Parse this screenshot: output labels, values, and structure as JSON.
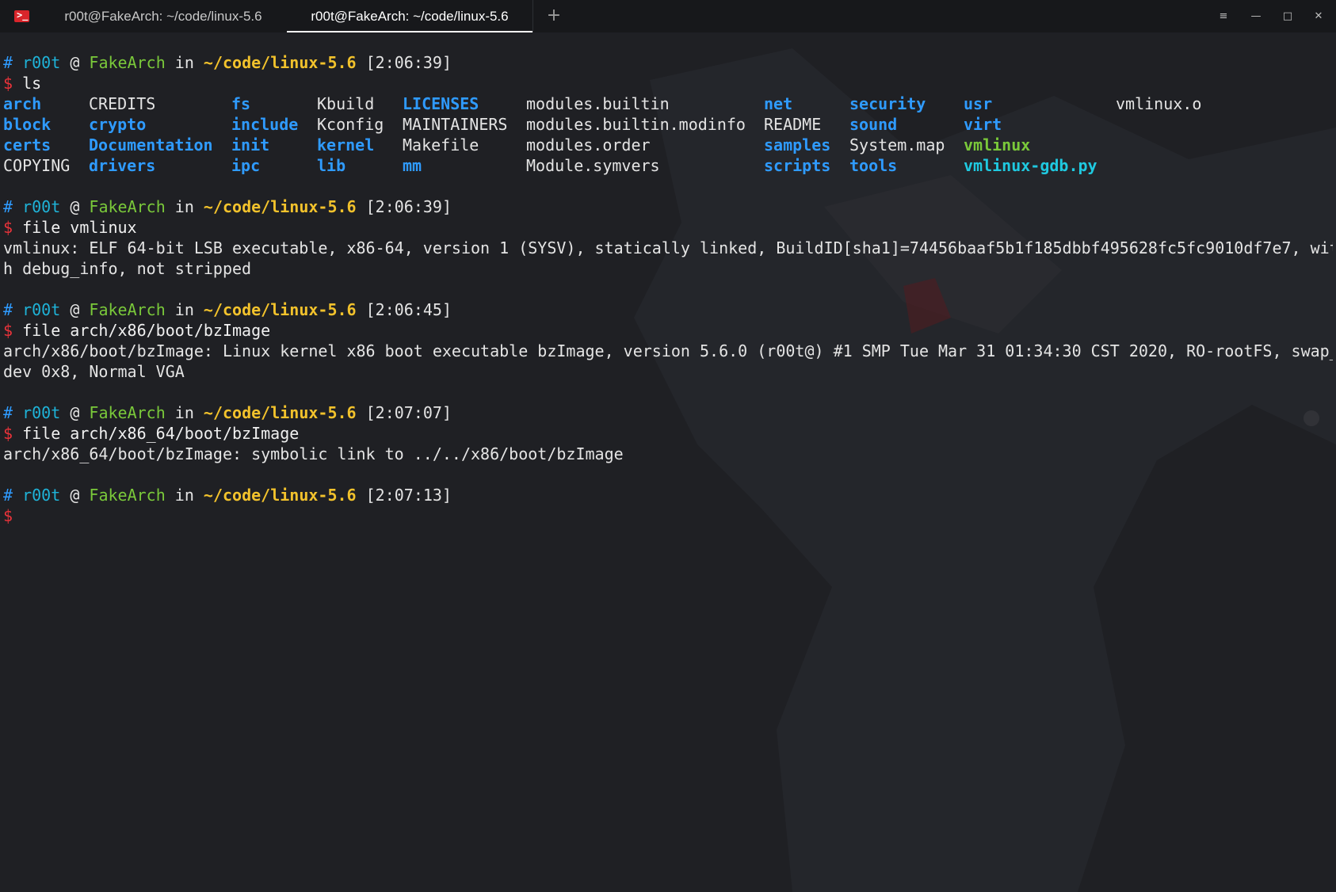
{
  "window": {
    "tabs": [
      {
        "label": "r00t@FakeArch: ~/code/linux-5.6",
        "active": false
      },
      {
        "label": "r00t@FakeArch: ~/code/linux-5.6",
        "active": true
      }
    ],
    "new_tab_symbol": "+",
    "controls": {
      "menu": "≡",
      "minimize": "—",
      "maximize": "□",
      "close": "✕"
    }
  },
  "colors": {
    "background": "#1f2024",
    "directory": "#2f9bff",
    "executable": "#7ac93a",
    "symlink": "#1fc9e0",
    "path": "#f2c22c",
    "dollar": "#e8333a",
    "host": "#7ac93a"
  },
  "prompt": {
    "hash": "#",
    "user": "r00t",
    "at": "@",
    "host": "FakeArch",
    "in": "in",
    "path": "~/code/linux-5.6",
    "dollar": "$"
  },
  "blocks": [
    {
      "time": "[2:06:39]",
      "command": "ls"
    },
    {
      "time": "[2:06:39]",
      "command": "file vmlinux",
      "output": [
        "vmlinux: ELF 64-bit LSB executable, x86-64, version 1 (SYSV), statically linked, BuildID[sha1]=74456baaf5b1f185dbbf495628fc5fc9010df7e7, wit",
        "h debug_info, not stripped"
      ]
    },
    {
      "time": "[2:06:45]",
      "command": "file arch/x86/boot/bzImage",
      "output": [
        "arch/x86/boot/bzImage: Linux kernel x86 boot executable bzImage, version 5.6.0 (r00t@) #1 SMP Tue Mar 31 01:34:30 CST 2020, RO-rootFS, swap_",
        "dev 0x8, Normal VGA"
      ]
    },
    {
      "time": "[2:07:07]",
      "command": "file arch/x86_64/boot/bzImage",
      "output": [
        "arch/x86_64/boot/bzImage: symbolic link to ../../x86/boot/bzImage"
      ]
    },
    {
      "time": "[2:07:13]",
      "command": ""
    }
  ],
  "ls_output": {
    "rows": [
      [
        {
          "n": "arch",
          "t": "dir"
        },
        {
          "n": "CREDITS",
          "t": "file"
        },
        {
          "n": "fs",
          "t": "dir"
        },
        {
          "n": "Kbuild",
          "t": "file"
        },
        {
          "n": "LICENSES",
          "t": "dir"
        },
        {
          "n": "modules.builtin",
          "t": "file"
        },
        {
          "n": "net",
          "t": "dir"
        },
        {
          "n": "security",
          "t": "dir"
        },
        {
          "n": "usr",
          "t": "dir"
        },
        {
          "n": "vmlinux.o",
          "t": "file"
        }
      ],
      [
        {
          "n": "block",
          "t": "dir"
        },
        {
          "n": "crypto",
          "t": "dir"
        },
        {
          "n": "include",
          "t": "dir"
        },
        {
          "n": "Kconfig",
          "t": "file"
        },
        {
          "n": "MAINTAINERS",
          "t": "file"
        },
        {
          "n": "modules.builtin.modinfo",
          "t": "file"
        },
        {
          "n": "README",
          "t": "file"
        },
        {
          "n": "sound",
          "t": "dir"
        },
        {
          "n": "virt",
          "t": "dir"
        },
        {
          "n": "",
          "t": "file"
        }
      ],
      [
        {
          "n": "certs",
          "t": "dir"
        },
        {
          "n": "Documentation",
          "t": "dir"
        },
        {
          "n": "init",
          "t": "dir"
        },
        {
          "n": "kernel",
          "t": "dir"
        },
        {
          "n": "Makefile",
          "t": "file"
        },
        {
          "n": "modules.order",
          "t": "file"
        },
        {
          "n": "samples",
          "t": "dir"
        },
        {
          "n": "System.map",
          "t": "file"
        },
        {
          "n": "vmlinux",
          "t": "exec"
        },
        {
          "n": "",
          "t": "file"
        }
      ],
      [
        {
          "n": "COPYING",
          "t": "file"
        },
        {
          "n": "drivers",
          "t": "dir"
        },
        {
          "n": "ipc",
          "t": "dir"
        },
        {
          "n": "lib",
          "t": "dir"
        },
        {
          "n": "mm",
          "t": "dir"
        },
        {
          "n": "Module.symvers",
          "t": "file"
        },
        {
          "n": "scripts",
          "t": "dir"
        },
        {
          "n": "tools",
          "t": "dir"
        },
        {
          "n": "vmlinux-gdb.py",
          "t": "link"
        },
        {
          "n": "",
          "t": "file"
        }
      ]
    ]
  }
}
